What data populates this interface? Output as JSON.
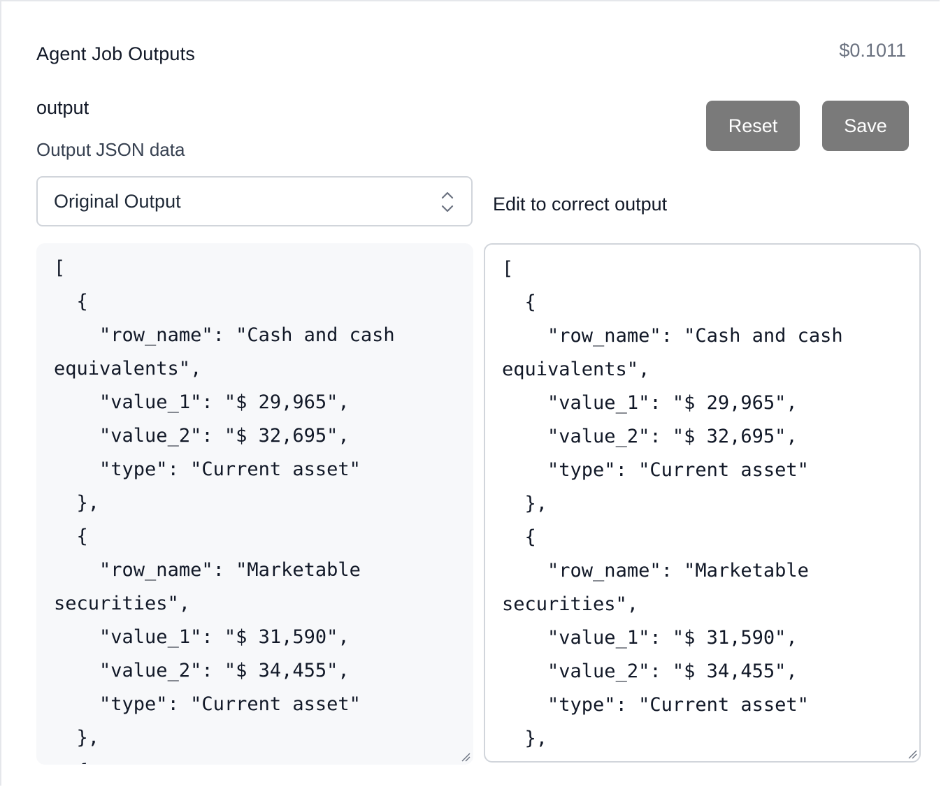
{
  "header": {
    "title": "Agent Job Outputs",
    "cost": "$0.1011"
  },
  "field": {
    "name": "output",
    "description": "Output JSON data"
  },
  "actions": {
    "reset_label": "Reset",
    "save_label": "Save"
  },
  "selector": {
    "selected": "Original Output",
    "icon": "chevron-up-down-icon"
  },
  "editor": {
    "label": "Edit to correct output"
  },
  "original_output": {
    "text": "[\n  {\n    \"row_name\": \"Cash and cash\nequivalents\",\n    \"value_1\": \"$ 29,965\",\n    \"value_2\": \"$ 32,695\",\n    \"type\": \"Current asset\"\n  },\n  {\n    \"row_name\": \"Marketable\nsecurities\",\n    \"value_1\": \"$ 31,590\",\n    \"value_2\": \"$ 34,455\",\n    \"type\": \"Current asset\"\n  },\n  {"
  },
  "edited_output": {
    "text": "[\n  {\n    \"row_name\": \"Cash and cash\nequivalents\",\n    \"value_1\": \"$ 29,965\",\n    \"value_2\": \"$ 32,695\",\n    \"type\": \"Current asset\"\n  },\n  {\n    \"row_name\": \"Marketable\nsecurities\",\n    \"value_1\": \"$ 31,590\",\n    \"value_2\": \"$ 34,455\",\n    \"type\": \"Current asset\"\n  },\n  {"
  },
  "colors": {
    "button_bg": "#7a7a7a",
    "code_bg": "#f7f8fa",
    "border": "#d1d5db",
    "muted_text": "#6b7280"
  }
}
